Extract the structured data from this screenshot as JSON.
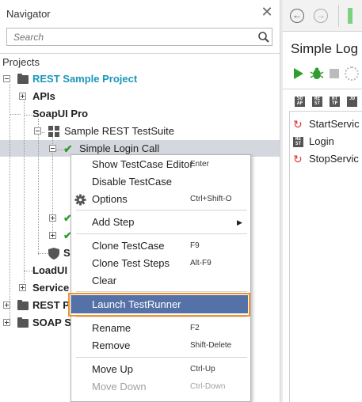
{
  "navigator": {
    "title": "Navigator",
    "close_icon": "close-icon",
    "search_placeholder": "Search",
    "projects_label": "Projects"
  },
  "tree": {
    "rest_sample_project": "REST Sample Project",
    "apis": "APIs",
    "soapui_pro": "SoapUI Pro",
    "sample_rest_testsuite": "Sample REST TestSuite",
    "simple_login_call": "Simple Login Call",
    "s_item": "S",
    "loadui": "LoadUI",
    "service": "Service",
    "rest_p": "REST P",
    "soap_s": "SOAP S"
  },
  "editor": {
    "title": "Simple Log",
    "steps": [
      {
        "label": "StartServic",
        "icon": "groovy-script-icon"
      },
      {
        "label": "Login",
        "icon": "rest-request-icon"
      },
      {
        "label": "StopServic",
        "icon": "groovy-script-icon"
      }
    ]
  },
  "context_menu": {
    "show_testcase_editor": {
      "label": "Show TestCase Editor",
      "shortcut": "Enter"
    },
    "disable_testcase": {
      "label": "Disable TestCase"
    },
    "options": {
      "label": "Options",
      "shortcut": "Ctrl+Shift-O"
    },
    "add_step": {
      "label": "Add Step"
    },
    "clone_testcase": {
      "label": "Clone TestCase",
      "shortcut": "F9"
    },
    "clone_test_steps": {
      "label": "Clone Test Steps",
      "shortcut": "Alt-F9"
    },
    "clear": {
      "label": "Clear"
    },
    "launch_testrunner": {
      "label": "Launch TestRunner"
    },
    "rename": {
      "label": "Rename",
      "shortcut": "F2"
    },
    "remove": {
      "label": "Remove",
      "shortcut": "Shift-Delete"
    },
    "move_up": {
      "label": "Move Up",
      "shortcut": "Ctrl-Up"
    },
    "move_down": {
      "label": "Move Down",
      "shortcut": "Ctrl-Down"
    }
  },
  "colors": {
    "project_link": "#1a98b8",
    "highlight_border": "#f0932b",
    "menu_selected": "#5572a8",
    "run_green": "#2f9e2f"
  }
}
